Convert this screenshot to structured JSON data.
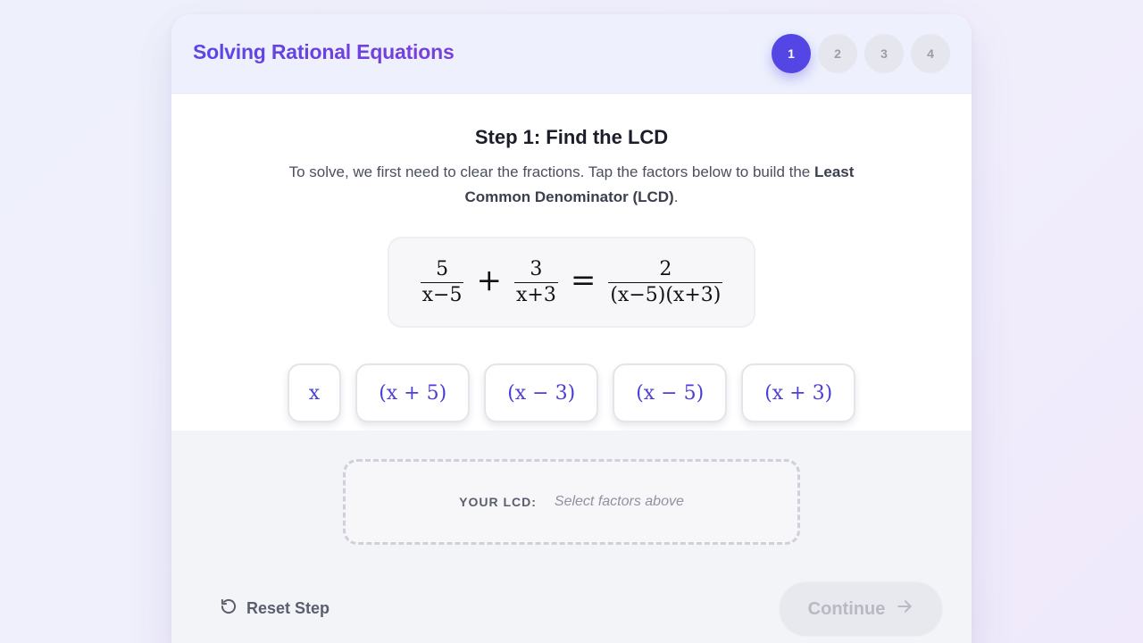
{
  "header": {
    "title": "Solving Rational Equations",
    "steps": [
      "1",
      "2",
      "3",
      "4"
    ],
    "active_step": "1"
  },
  "content": {
    "step_title": "Step 1: Find the LCD",
    "description_part1": "To solve, we first need to clear the fractions. Tap the factors below to build the",
    "description_bold": "Least Common Denominator (LCD)",
    "description_end": "."
  },
  "equation": {
    "term1_num": "5",
    "term1_den": "x−5",
    "plus": "+",
    "term2_num": "3",
    "term2_den": "x+3",
    "equals": "=",
    "rhs_num": "2",
    "rhs_den": "(x−5)(x+3)"
  },
  "factors": [
    "x",
    "(x + 5)",
    "(x − 3)",
    "(x − 5)",
    "(x + 3)"
  ],
  "lcd": {
    "label": "YOUR LCD:",
    "placeholder": "Select factors above"
  },
  "actions": {
    "reset_label": "Reset Step",
    "continue_label": "Continue"
  },
  "colors": {
    "accent": "#5446e5",
    "title_gradient_start": "#5b46e6",
    "title_gradient_end": "#7a3fd9",
    "disabled_text": "#b7b9c4"
  },
  "icons": {
    "reset": "rotate-ccw-icon",
    "continue": "arrow-right-icon"
  }
}
